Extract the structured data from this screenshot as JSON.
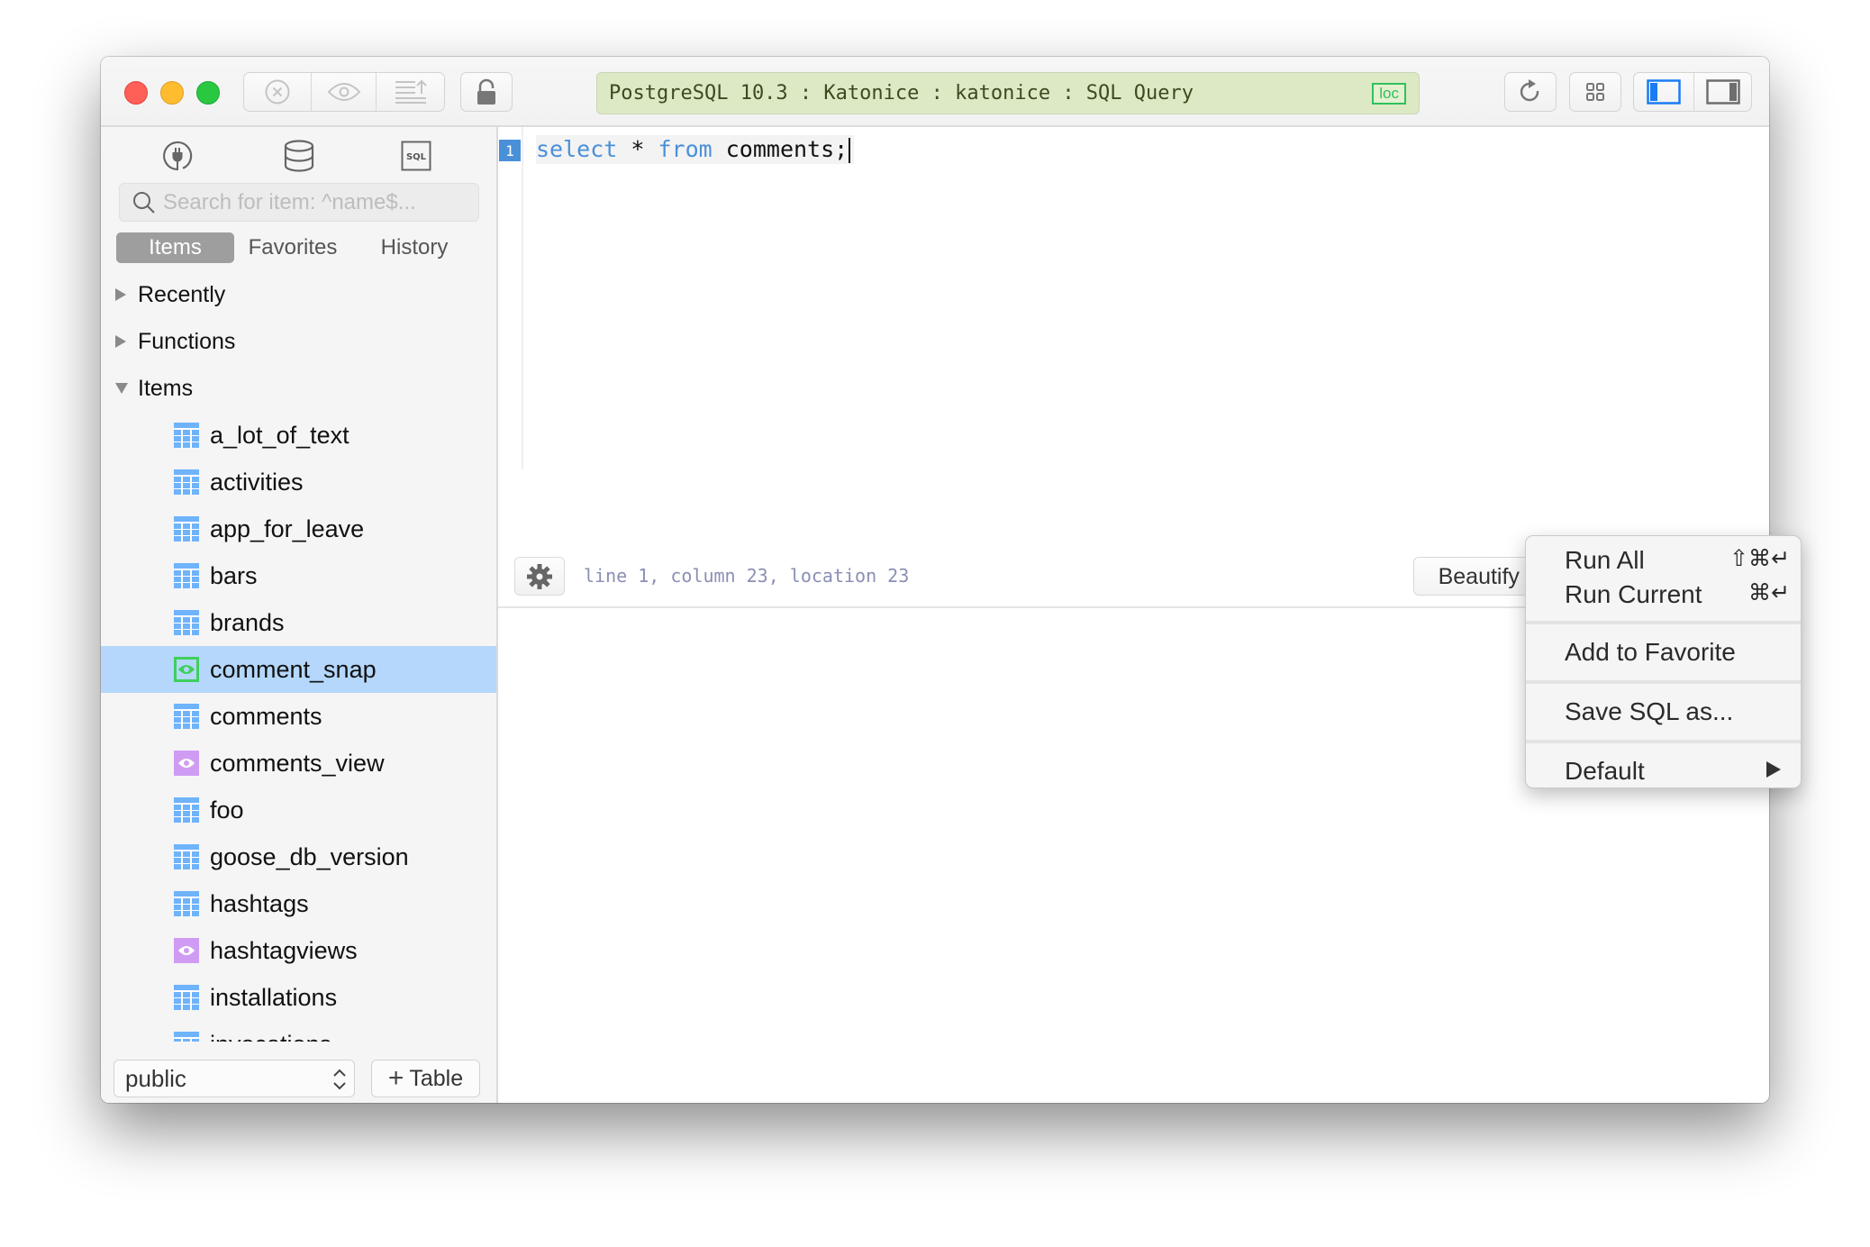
{
  "toolbar": {
    "connection_info": "PostgreSQL 10.3 : Katonice : katonice : SQL Query",
    "connection_badge": "loc",
    "connection_color": "#dde9c5",
    "left_buttons": [
      "stop-icon",
      "preview-icon",
      "upload-list-icon"
    ],
    "lock_icon": "lock-open-icon",
    "right_buttons": [
      "refresh-icon",
      "grid-icon",
      "toggle-left-panel-icon",
      "toggle-right-panel-icon"
    ]
  },
  "sidebar": {
    "icons": [
      "connection-plug-icon",
      "database-icon",
      "sql-file-icon"
    ],
    "search": {
      "placeholder": "Search for item: ^name$...",
      "value": ""
    },
    "tabs": [
      {
        "label": "Items",
        "active": true
      },
      {
        "label": "Favorites",
        "active": false
      },
      {
        "label": "History",
        "active": false
      }
    ],
    "groups": [
      {
        "label": "Recently",
        "expanded": false
      },
      {
        "label": "Functions",
        "expanded": false
      },
      {
        "label": "Items",
        "expanded": true
      }
    ],
    "items": [
      {
        "name": "a_lot_of_text",
        "type": "table"
      },
      {
        "name": "activities",
        "type": "table"
      },
      {
        "name": "app_for_leave",
        "type": "table"
      },
      {
        "name": "bars",
        "type": "table"
      },
      {
        "name": "brands",
        "type": "table"
      },
      {
        "name": "comment_snap",
        "type": "materialized-view",
        "selected": true
      },
      {
        "name": "comments",
        "type": "table"
      },
      {
        "name": "comments_view",
        "type": "view"
      },
      {
        "name": "foo",
        "type": "table"
      },
      {
        "name": "goose_db_version",
        "type": "table"
      },
      {
        "name": "hashtags",
        "type": "table"
      },
      {
        "name": "hashtagviews",
        "type": "view"
      },
      {
        "name": "installations",
        "type": "table"
      },
      {
        "name": "invocations",
        "type": "table"
      }
    ],
    "schema_select": "public",
    "add_table_label": "Table"
  },
  "editor": {
    "line_number": "1",
    "tokens": [
      {
        "text": "select",
        "kind": "keyword"
      },
      {
        "text": " * ",
        "kind": "plain"
      },
      {
        "text": "from",
        "kind": "keyword"
      },
      {
        "text": " comments;",
        "kind": "plain"
      }
    ],
    "cursor_position": "line 1, column 23, location 23",
    "beautify_label": "Beautify ⌘I",
    "run_label": "Run Current"
  },
  "run_menu": {
    "items": [
      {
        "label": "Run All",
        "shortcut": "⇧⌘↵"
      },
      {
        "label": "Run Current",
        "shortcut": "⌘↵"
      },
      {
        "label": "Add to Favorite"
      },
      {
        "label": "Save SQL as..."
      },
      {
        "label": "Default",
        "submenu": true
      }
    ]
  }
}
